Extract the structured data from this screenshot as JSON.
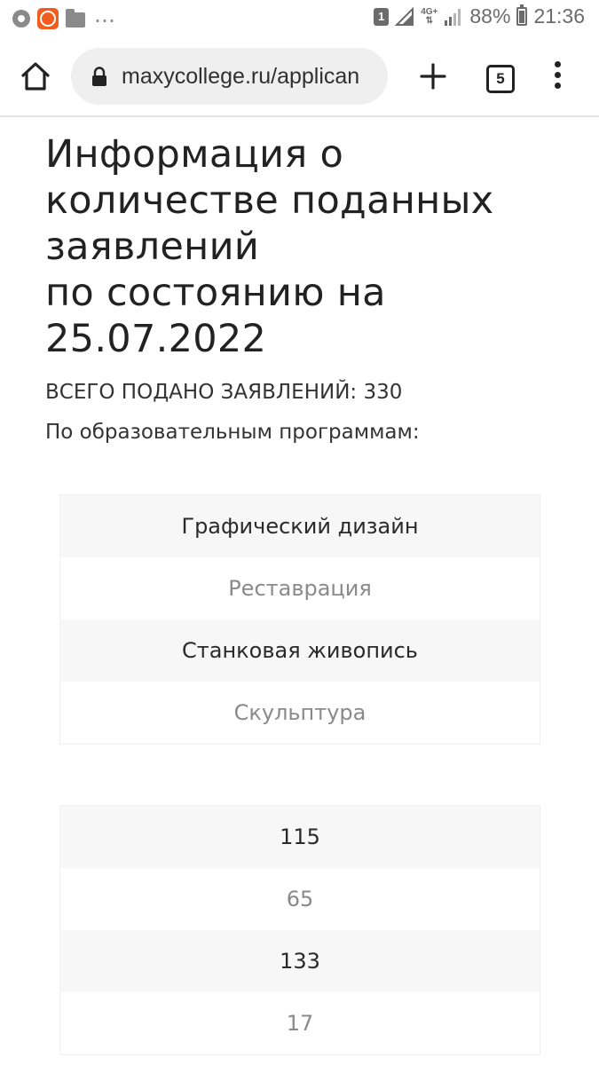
{
  "status_bar": {
    "notification_badge": "1",
    "network_type": "4G+",
    "battery_percent": "88%",
    "time": "21:36",
    "icons": [
      "chrome-icon",
      "orange-app-icon",
      "folder-icon",
      "more-dots-icon",
      "notification-badge-icon",
      "signal-icon",
      "signal-icon",
      "battery-icon"
    ]
  },
  "browser": {
    "url": "maxycollege.ru/applican",
    "tab_count": "5",
    "icons": [
      "home-icon",
      "lock-icon",
      "new-tab-plus-icon",
      "tab-switcher-icon",
      "overflow-menu-icon"
    ]
  },
  "page": {
    "title": "Информация о количестве поданных заявлений\nпо состоянию на 25.07.2022",
    "total": "ВСЕГО ПОДАНО ЗАЯВЛЕНИЙ: 330",
    "by_programs": "По образовательным программам:"
  },
  "programs_table": [
    "Графический дизайн",
    "Реставрация",
    "Станковая живопись",
    "Скульптура"
  ],
  "counts_table": [
    "115",
    "65",
    "133",
    "17"
  ]
}
